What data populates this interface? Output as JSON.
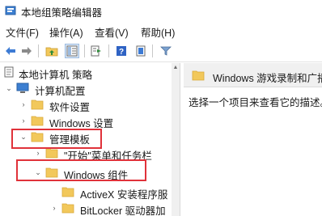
{
  "window": {
    "title": "本地组策略编辑器"
  },
  "menu": {
    "items": [
      "文件(F)",
      "操作(A)",
      "查看(V)",
      "帮助(H)"
    ]
  },
  "toolbar": {
    "icons": [
      "back-icon",
      "forward-icon",
      "up-folder-icon",
      "show-hide-tree-icon",
      "export-list-icon",
      "help-icon",
      "properties-icon",
      "filter-icon"
    ]
  },
  "tree": {
    "root": "本地计算机 策略",
    "computer_config": "计算机配置",
    "software_settings": "软件设置",
    "windows_settings": "Windows 设置",
    "admin_templates": "管理模板",
    "start_menu_taskbar": "\"开始\"菜单和任务栏",
    "windows_components": "Windows 组件",
    "activex": "ActiveX 安装程序服",
    "bitlocker": "BitLocker 驱动器加"
  },
  "right_pane": {
    "header_title": "Windows 游戏录制和广播",
    "description": "选择一个项目来查看它的描述。"
  },
  "colors": {
    "highlight": "#e0323a",
    "folder": "#f2c85b",
    "folder_dark": "#d9a93a"
  }
}
